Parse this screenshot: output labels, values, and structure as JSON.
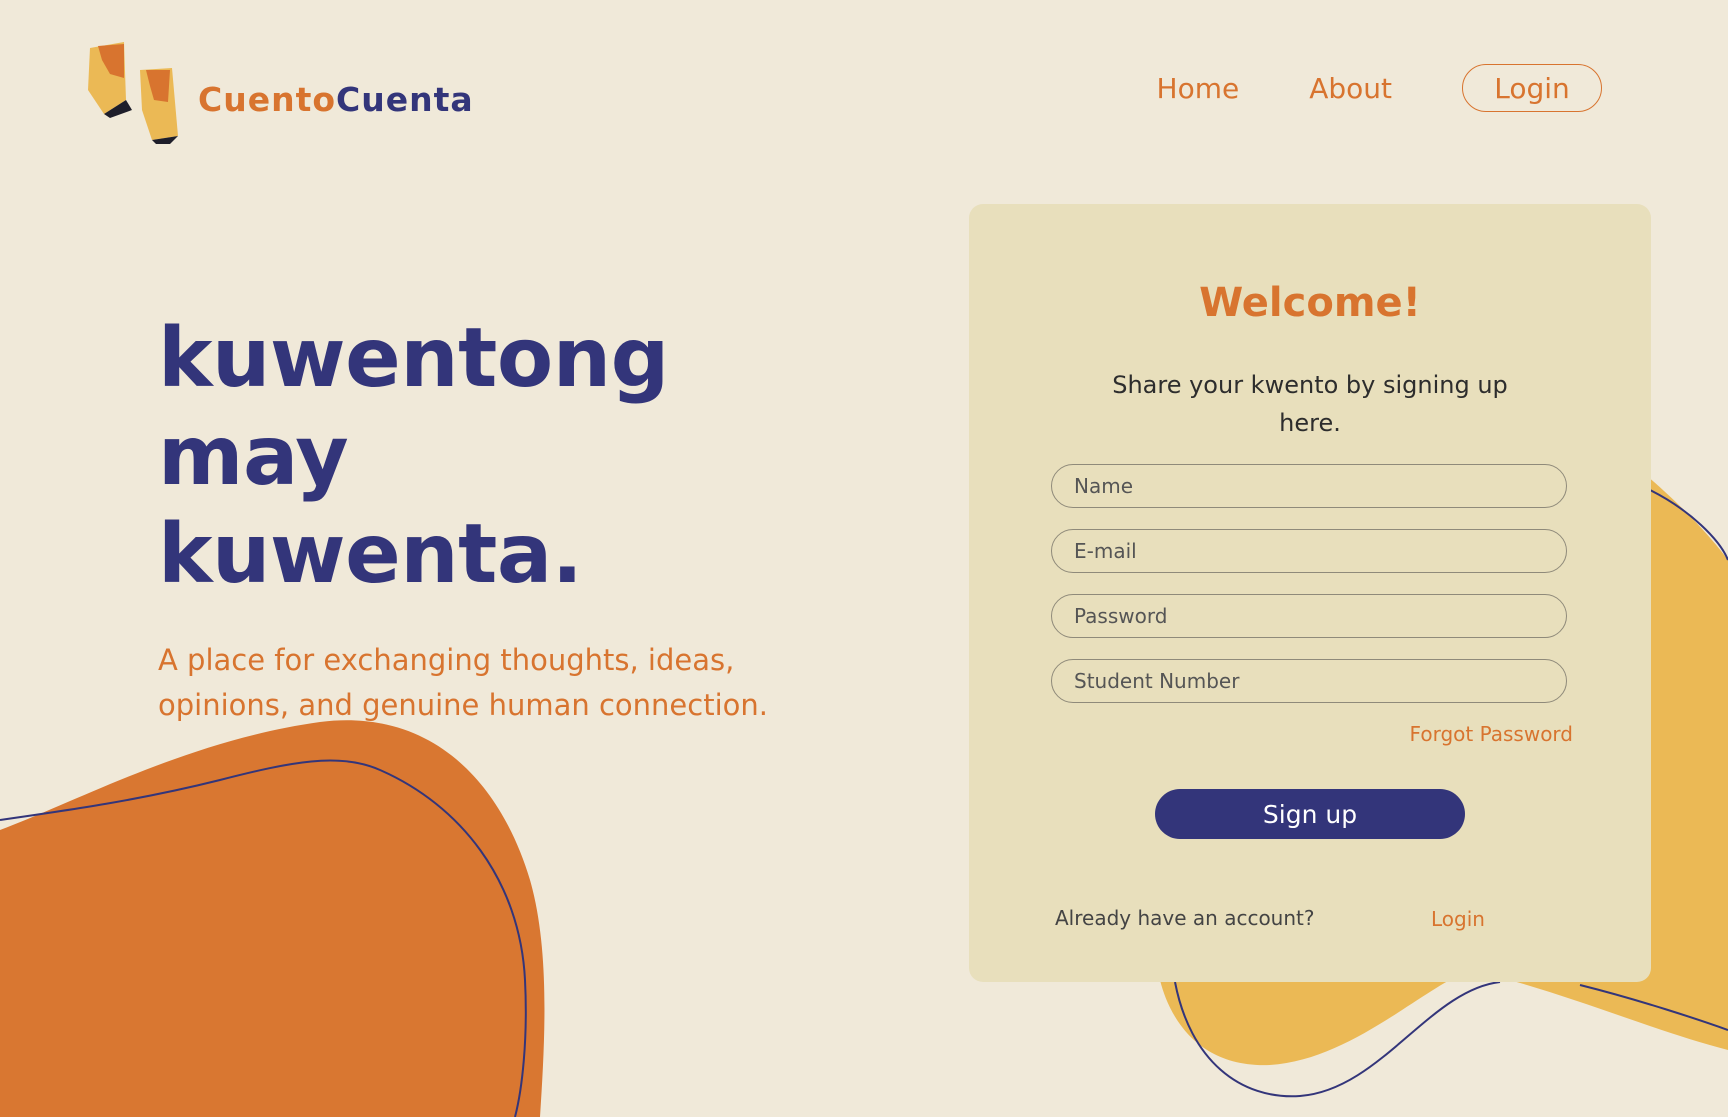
{
  "brand": {
    "part1": "Cuento",
    "part2": "Cuenta"
  },
  "nav": {
    "home": "Home",
    "about": "About",
    "login": "Login"
  },
  "hero": {
    "line1": "kuwentong",
    "line2": "may",
    "line3": "kuwenta.",
    "subtitle": "A place for exchanging thoughts, ideas, opinions, and genuine human connection."
  },
  "signup_card": {
    "title": "Welcome!",
    "subtitle": "Share your kwento by signing up here.",
    "fields": {
      "name_placeholder": "Name",
      "email_placeholder": "E-mail",
      "password_placeholder": "Password",
      "student_number_placeholder": "Student Number"
    },
    "forgot_password": "Forgot Password",
    "signup_button": "Sign up",
    "already_account": "Already have an account?",
    "login_link": "Login"
  },
  "colors": {
    "background": "#f0e9d9",
    "orange": "#d8742f",
    "navy": "#33357a",
    "card": "#e8dfbc",
    "yellow_blob": "#ebb955"
  }
}
